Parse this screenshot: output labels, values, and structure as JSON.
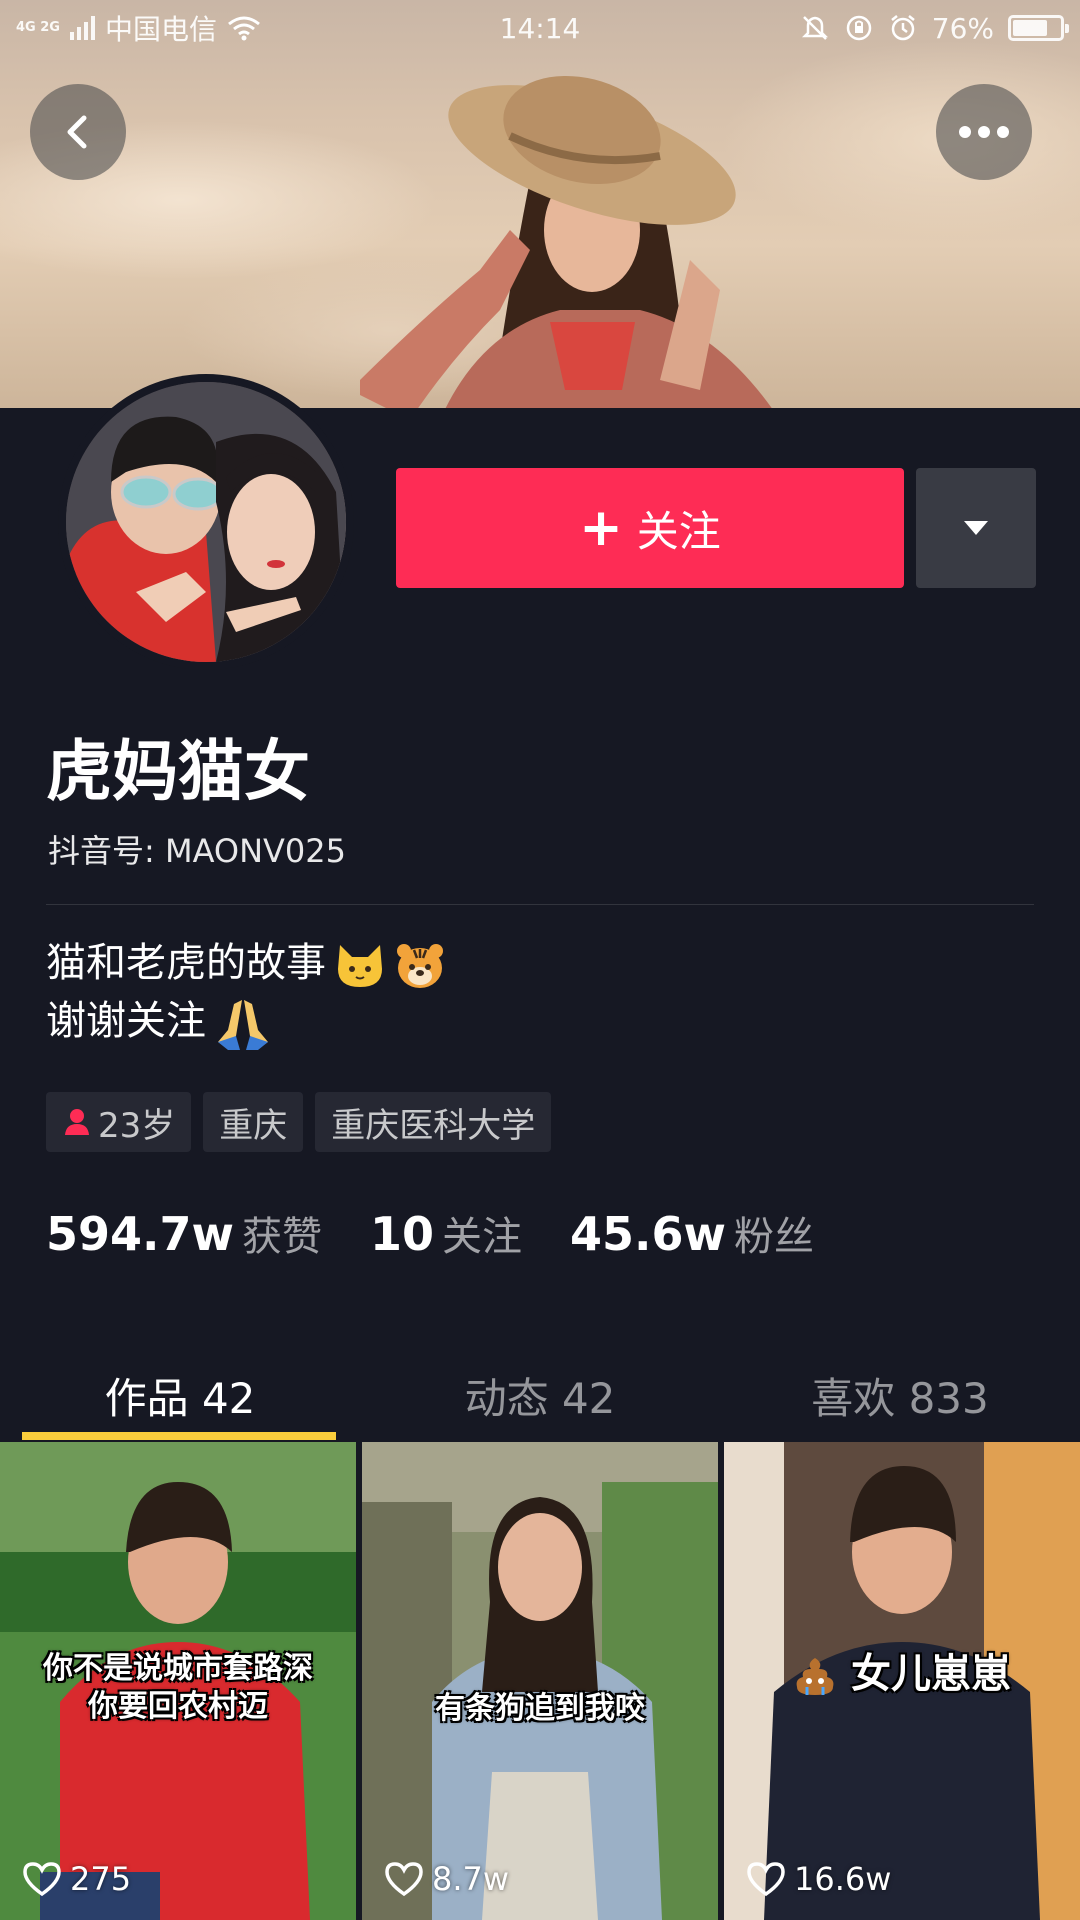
{
  "status_bar": {
    "network": "4G 2G",
    "carrier": "中国电信",
    "time": "14:14",
    "battery": "76%",
    "battery_level": 0.76
  },
  "header": {
    "back_icon": "back-icon",
    "more_icon": "more-icon"
  },
  "profile": {
    "follow_label": "关注",
    "nickname": "虎妈猫女",
    "douyin_id": "抖音号: MAONV025",
    "bio_line1": "猫和老虎的故事",
    "bio_line2": "谢谢关注",
    "tags": [
      "23岁",
      "重庆",
      "重庆医科大学"
    ],
    "stats": [
      {
        "num": "594.7w",
        "label": "获赞"
      },
      {
        "num": "10",
        "label": "关注"
      },
      {
        "num": "45.6w",
        "label": "粉丝"
      }
    ]
  },
  "tabs": [
    {
      "label": "作品 42",
      "active": true
    },
    {
      "label": "动态 42",
      "active": false
    },
    {
      "label": "喜欢 833",
      "active": false
    }
  ],
  "videos": [
    {
      "caption_line1": "你不是说城市套路深",
      "caption_line2": "你要回农村迈",
      "likes": "275"
    },
    {
      "caption_line1": "有条狗追到我咬",
      "caption_line2": "",
      "likes": "8.7w"
    },
    {
      "caption_line1": "女儿崽崽",
      "caption_line2": "",
      "likes": "16.6w"
    }
  ],
  "colors": {
    "background": "#161823",
    "follow_button": "#fe2c55",
    "tab_indicator": "#facd3c"
  }
}
